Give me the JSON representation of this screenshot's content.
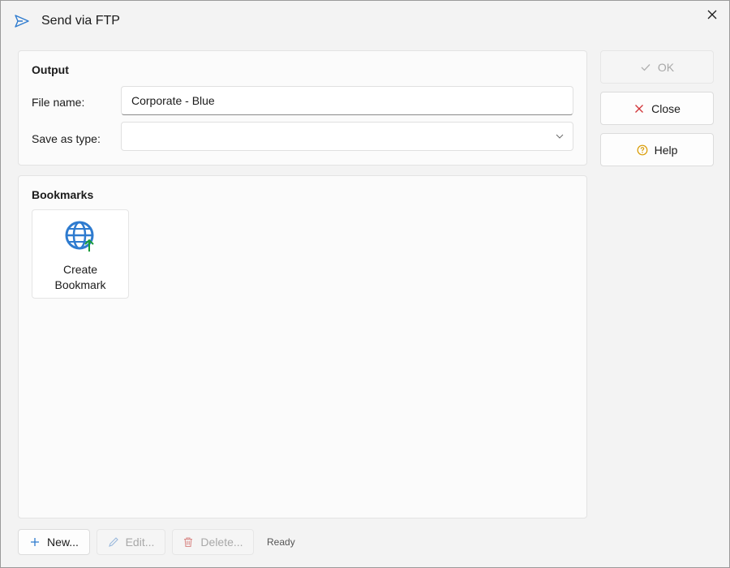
{
  "window": {
    "title": "Send via FTP",
    "title_icon": "send-icon",
    "close_icon": "close-icon"
  },
  "output": {
    "heading": "Output",
    "file_name_label": "File name:",
    "file_name_value": "Corporate - Blue",
    "save_as_label": "Save as type:",
    "save_as_value": ""
  },
  "bookmarks": {
    "heading": "Bookmarks",
    "items": [
      {
        "label_line1": "Create",
        "label_line2": "Bookmark",
        "icon": "globe-add-icon"
      }
    ]
  },
  "side_buttons": {
    "ok": "OK",
    "close": "Close",
    "help": "Help"
  },
  "bottom_buttons": {
    "new": "New...",
    "edit": "Edit...",
    "delete": "Delete..."
  },
  "status": "Ready",
  "colors": {
    "accent": "#2e7bcf",
    "close_red": "#d13438",
    "help_yellow": "#d99a00",
    "new_bookmark_green": "#1a9c3a",
    "delete_red": "#c4312b"
  }
}
